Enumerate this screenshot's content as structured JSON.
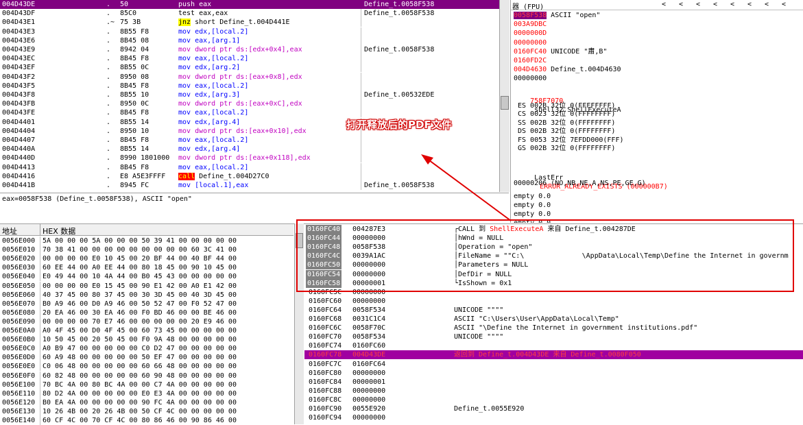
{
  "disasm": {
    "rows": [
      {
        "addr": "004D43DE",
        "mark": ".",
        "bytes": "50",
        "instr": "push eax",
        "color": "sel",
        "comment": "Define_t.0058F538"
      },
      {
        "addr": "004D43DF",
        "mark": ".",
        "bytes": "85C0",
        "instr": "test eax,eax",
        "color": "black",
        "comment": "Define_t.0058F538"
      },
      {
        "addr": "004D43E1",
        "mark": ".~",
        "bytes": "75 3B",
        "instr": "jnz short Define_t.004D441E",
        "color": "jnz",
        "comment": ""
      },
      {
        "addr": "004D43E3",
        "mark": ".",
        "bytes": "8B55 F8",
        "instr": "mov edx,[local.2]",
        "color": "blue",
        "comment": ""
      },
      {
        "addr": "004D43E6",
        "mark": ".",
        "bytes": "8B45 08",
        "instr": "mov eax,[arg.1]",
        "color": "blue",
        "comment": ""
      },
      {
        "addr": "004D43E9",
        "mark": ".",
        "bytes": "8942 04",
        "instr": "mov dword ptr ds:[edx+0x4],eax",
        "color": "magenta",
        "comment": "Define_t.0058F538"
      },
      {
        "addr": "004D43EC",
        "mark": ".",
        "bytes": "8B45 F8",
        "instr": "mov eax,[local.2]",
        "color": "blue",
        "comment": ""
      },
      {
        "addr": "004D43EF",
        "mark": ".",
        "bytes": "8B55 0C",
        "instr": "mov edx,[arg.2]",
        "color": "blue",
        "comment": ""
      },
      {
        "addr": "004D43F2",
        "mark": ".",
        "bytes": "8950 08",
        "instr": "mov dword ptr ds:[eax+0x8],edx",
        "color": "magenta",
        "comment": ""
      },
      {
        "addr": "004D43F5",
        "mark": ".",
        "bytes": "8B45 F8",
        "instr": "mov eax,[local.2]",
        "color": "blue",
        "comment": ""
      },
      {
        "addr": "004D43F8",
        "mark": ".",
        "bytes": "8B55 10",
        "instr": "mov edx,[arg.3]",
        "color": "blue",
        "comment": "Define_t.00532EDE"
      },
      {
        "addr": "004D43FB",
        "mark": ".",
        "bytes": "8950 0C",
        "instr": "mov dword ptr ds:[eax+0xC],edx",
        "color": "magenta",
        "comment": ""
      },
      {
        "addr": "004D43FE",
        "mark": ".",
        "bytes": "8B45 F8",
        "instr": "mov eax,[local.2]",
        "color": "blue",
        "comment": ""
      },
      {
        "addr": "004D4401",
        "mark": ".",
        "bytes": "8B55 14",
        "instr": "mov edx,[arg.4]",
        "color": "blue",
        "comment": ""
      },
      {
        "addr": "004D4404",
        "mark": ".",
        "bytes": "8950 10",
        "instr": "mov dword ptr ds:[eax+0x10],edx",
        "color": "magenta",
        "comment": ""
      },
      {
        "addr": "004D4407",
        "mark": ".",
        "bytes": "8B45 F8",
        "instr": "mov eax,[local.2]",
        "color": "blue",
        "comment": ""
      },
      {
        "addr": "004D440A",
        "mark": ".",
        "bytes": "8B55 14",
        "instr": "mov edx,[arg.4]",
        "color": "blue",
        "comment": ""
      },
      {
        "addr": "004D440D",
        "mark": ".",
        "bytes": "8990 1801000",
        "instr": "mov dword ptr ds:[eax+0x118],edx",
        "color": "magenta",
        "comment": ""
      },
      {
        "addr": "004D4413",
        "mark": ".",
        "bytes": "8B45 F8",
        "instr": "mov eax,[local.2]",
        "color": "blue",
        "comment": ""
      },
      {
        "addr": "004D4416",
        "mark": ".",
        "bytes": "E8 A5E3FFFF",
        "instr": "call Define_t.004D27C0",
        "color": "call",
        "comment": ""
      },
      {
        "addr": "004D441B",
        "mark": ".",
        "bytes": "8945 FC",
        "instr": "mov [local.1],eax",
        "color": "blue",
        "comment": "Define_t.0058F538"
      }
    ],
    "info": "eax=0058F538 (Define_t.0058F538), ASCII \"open\""
  },
  "registers": {
    "title": "器 (FPU)",
    "nav": [
      "<",
      "<",
      "<",
      "<",
      "<",
      "<",
      "<",
      "<"
    ],
    "values": [
      {
        "v": "0058F538",
        "note": "ASCII \"open\"",
        "sel": true
      },
      {
        "v": "003A9DBC",
        "note": "",
        "red": true
      },
      {
        "v": "0000000D",
        "note": "",
        "red": true
      },
      {
        "v": "00000000",
        "note": "",
        "red": true
      },
      {
        "v": "0160FC40",
        "note": "UNICODE \"肅,B\"",
        "red": true
      },
      {
        "v": "0160FD2C",
        "note": "",
        "red": true
      },
      {
        "v": "004D4630",
        "note": "Define_t.004D4630",
        "red": true
      },
      {
        "v": "00000000",
        "note": "",
        "red": false
      }
    ],
    "eip": {
      "v": "758F7070",
      "note": "shell32.ShellExecuteA"
    },
    "segs": [
      "ES 002B 32位 0(FFFFFFFF)",
      "CS 0023 32位 0(FFFFFFFF)",
      "SS 002B 32位 0(FFFFFFFF)",
      "DS 002B 32位 0(FFFFFFFF)",
      "FS 0053 32位 7EFDD000(FFF)",
      "GS 002B 32位 0(FFFFFFFF)"
    ],
    "lasterr_label": "LastErr",
    "lasterr_value": "ERROR_ALREADY_EXISTS (000000B7)",
    "eflags": "00000206 (NO,NB,NE,A,NS,PE,GE,G)",
    "fpu": [
      "empty 0.0",
      "empty 0.0",
      "empty 0.0",
      "empty 0.0"
    ]
  },
  "dump": {
    "header_addr": "地址",
    "header_hex": "HEX 数据",
    "rows": [
      {
        "a": "0056E000",
        "h": "5A 00 00 00 5A 00 00 00 50 39 41 00 00 00 00 00"
      },
      {
        "a": "0056E010",
        "h": "70 38 41 00 00 00 00 00 00 00 00 00 60 3C 41 00"
      },
      {
        "a": "0056E020",
        "h": "00 00 00 00 E0 10 45 00 20 BF 44 00 40 BF 44 00"
      },
      {
        "a": "0056E030",
        "h": "60 EE 44 00 A0 EE 44 00 80 18 45 00 90 10 45 00"
      },
      {
        "a": "0056E040",
        "h": "E0 49 44 00 10 4A 44 00 B0 45 43 00 00 00 00 00"
      },
      {
        "a": "0056E050",
        "h": "00 00 00 00 E0 15 45 00 90 E1 42 00 A0 E1 42 00"
      },
      {
        "a": "0056E060",
        "h": "40 37 45 00 80 37 45 00 30 3D 45 00 40 3D 45 00"
      },
      {
        "a": "0056E070",
        "h": "B0 A9 46 00 D0 A9 46 00 50 52 47 00 F0 52 47 00"
      },
      {
        "a": "0056E080",
        "h": "20 EA 46 00 30 EA 46 00 F0 BD 46 00 00 BE 46 00"
      },
      {
        "a": "0056E090",
        "h": "00 00 00 00 70 E7 46 00 00 00 00 00 20 E9 46 00"
      },
      {
        "a": "0056E0A0",
        "h": "A0 4F 45 00 D0 4F 45 00 60 73 45 00 00 00 00 00"
      },
      {
        "a": "0056E0B0",
        "h": "10 50 45 00 20 50 45 00 F0 9A 48 00 00 00 00 00"
      },
      {
        "a": "0056E0C0",
        "h": "A0 B9 47 00 00 00 00 00 C0 D2 47 00 00 00 00 00"
      },
      {
        "a": "0056E0D0",
        "h": "60 A9 48 00 00 00 00 00 50 EF 47 00 00 00 00 00"
      },
      {
        "a": "0056E0E0",
        "h": "C0 06 48 00 00 00 00 00 60 66 48 00 00 00 00 00"
      },
      {
        "a": "0056E0F0",
        "h": "60 82 48 00 00 00 00 00 60 90 48 00 00 00 00 00"
      },
      {
        "a": "0056E100",
        "h": "70 BC 4A 00 80 BC 4A 00 00 C7 4A 00 00 00 00 00"
      },
      {
        "a": "0056E110",
        "h": "80 D2 4A 00 00 00 00 00 E0 E3 4A 00 00 00 00 00"
      },
      {
        "a": "0056E120",
        "h": "B0 EA 4A 00 00 00 00 00 90 FC 4A 00 00 00 00 00"
      },
      {
        "a": "0056E130",
        "h": "10 26 4B 00 20 26 4B 00 50 CF 4C 00 00 00 00 00"
      },
      {
        "a": "0056E140",
        "h": "60 CF 4C 00 70 CF 4C 00 80 86 46 00 90 86 46 00"
      }
    ]
  },
  "stack": {
    "rows": [
      {
        "a": "0160FC40",
        "v": "004287E3",
        "c": "┌CALL 到 ",
        "c_red": "ShellExecuteA",
        "c2": " 来自 Define_t.004287DE"
      },
      {
        "a": "0160FC44",
        "v": "00000000",
        "c": "│hWnd = NULL"
      },
      {
        "a": "0160FC48",
        "v": "0058F538",
        "c": "│Operation = \"open\""
      },
      {
        "a": "0160FC4C",
        "v": "0039A1AC",
        "c": "│FileName = \"\"C:\\              \\AppData\\Local\\Temp\\Define the Internet in governm"
      },
      {
        "a": "0160FC50",
        "v": "00000000",
        "c": "│Parameters = NULL"
      },
      {
        "a": "0160FC54",
        "v": "00000000",
        "c": "│DefDir = NULL"
      },
      {
        "a": "0160FC58",
        "v": "00000001",
        "c": "└IsShown = 0x1"
      },
      {
        "a": "0160FC5C",
        "v": "00000000",
        "c": ""
      },
      {
        "a": "0160FC60",
        "v": "00000000",
        "c": ""
      },
      {
        "a": "0160FC64",
        "v": "0058F534",
        "c": "UNICODE \"\"\"\""
      },
      {
        "a": "0160FC68",
        "v": "0031C1C4",
        "c": "ASCII \"C:\\Users\\User\\AppData\\Local\\Temp\""
      },
      {
        "a": "0160FC6C",
        "v": "0058F70C",
        "c": "ASCII \"\\Define the Internet in government institutions.pdf\""
      },
      {
        "a": "0160FC70",
        "v": "0058F534",
        "c": "UNICODE \"\"\"\""
      },
      {
        "a": "0160FC74",
        "v": "0160FC60",
        "c": ""
      },
      {
        "a": "0160FC78",
        "v": "004D43DE",
        "c": "返回到 Define_t.004D43DE 来自 Define_t.0080F050",
        "sel": true
      },
      {
        "a": "0160FC7C",
        "v": "0160FC64",
        "c": ""
      },
      {
        "a": "0160FC80",
        "v": "00000000",
        "c": ""
      },
      {
        "a": "0160FC84",
        "v": "00000001",
        "c": ""
      },
      {
        "a": "0160FC88",
        "v": "00000000",
        "c": ""
      },
      {
        "a": "0160FC8C",
        "v": "00000000",
        "c": ""
      },
      {
        "a": "0160FC90",
        "v": "0055E920",
        "c": "Define_t.0055E920"
      },
      {
        "a": "0160FC94",
        "v": "00000000",
        "c": ""
      }
    ]
  },
  "annotation": {
    "text": "打开释放后的PDF文件",
    "color": "#e00000"
  }
}
